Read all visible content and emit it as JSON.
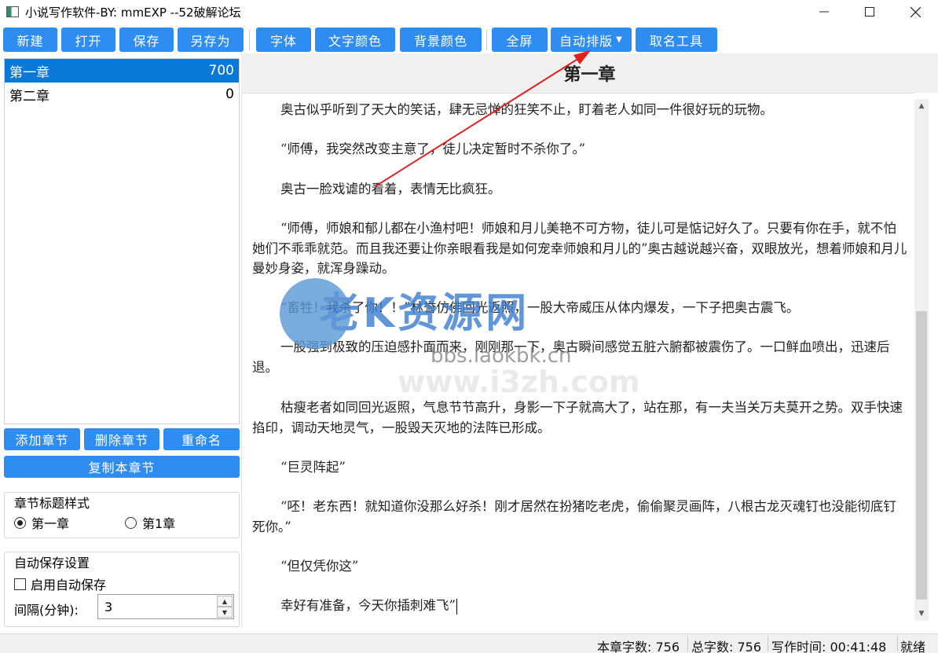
{
  "window": {
    "title": "小说写作软件-BY: mmEXP --52破解论坛",
    "minimize": "─",
    "maximize": "☐",
    "close": "✕"
  },
  "toolbar": {
    "new": "新建",
    "open": "打开",
    "save": "保存",
    "save_as": "另存为",
    "font": "字体",
    "text_color": "文字颜色",
    "bg_color": "背景颜色",
    "fullscreen": "全屏",
    "auto_format": "自动排版",
    "naming_tool": "取名工具"
  },
  "chapters": [
    {
      "name": "第一章",
      "count": "700"
    },
    {
      "name": "第二章",
      "count": "0"
    }
  ],
  "chapter_buttons": {
    "add": "添加章节",
    "delete": "删除章节",
    "rename": "重命名",
    "copy": "复制本章节"
  },
  "title_style": {
    "label": "章节标题样式",
    "option1": "第一章",
    "option2": "第1章",
    "selected": "第一章"
  },
  "autosave": {
    "label": "自动保存设置",
    "enable_label": "启用自动保存",
    "enabled": false,
    "interval_label": "间隔(分钟):",
    "interval_value": "3"
  },
  "editor": {
    "chapter_title": "第一章",
    "paragraphs": [
      "奥古似乎听到了天大的笑话，肆无忌惮的狂笑不止，盯着老人如同一件很好玩的玩物。",
      "“师傅，我突然改变主意了，徒儿决定暂时不杀你了。”",
      "奥古一脸戏谑的看着，表情无比疯狂。",
      "“师傅，师娘和郁儿都在小渔村吧！师娘和月儿美艳不可方物，徒儿可是惦记好久了。只要有你在手，就不怕她们不乖乖就范。而且我还要让你亲眼看我是如何宠幸师娘和月儿的”奥古越说越兴奋，双眼放光，想着师娘和月儿曼妙身姿，就浑身躁动。",
      "“畜牲！我杀了你！！”林誉仿佛回光返照，一股大帝威压从体内爆发，一下子把奥古震飞。",
      "一股强到极致的压迫感扑面而来，刚刚那一下，奥古瞬间感觉五脏六腑都被震伤了。一口鲜血喷出，迅速后退。",
      "枯瘦老者如同回光返照，气息节节高升，身影一下子就高大了，站在那，有一夫当关万夫莫开之势。双手快速掐印，调动天地灵气，一股毁天灭地的法阵已形成。",
      "“巨灵阵起”",
      "“呸！老东西！就知道你没那么好杀！刚才居然在扮猪吃老虎，偷偷聚灵画阵，八根古龙灭魂钉也没能彻底钉死你。”",
      "“但仅凭你这”",
      "幸好有准备，今天你插刺难飞”"
    ]
  },
  "watermark": {
    "brand": "老K资源网",
    "url": "bbs.laokbk.cn",
    "url2": "www.i3zh.com"
  },
  "status": {
    "chapter_words": "本章字数: 756",
    "total_words": "总字数: 756",
    "writing_time": "写作时间: 00:41:48",
    "state": "就绪"
  },
  "colors": {
    "accent": "#2f8cf0",
    "selection": "#0a78d7",
    "annotation_arrow": "#e02020"
  }
}
